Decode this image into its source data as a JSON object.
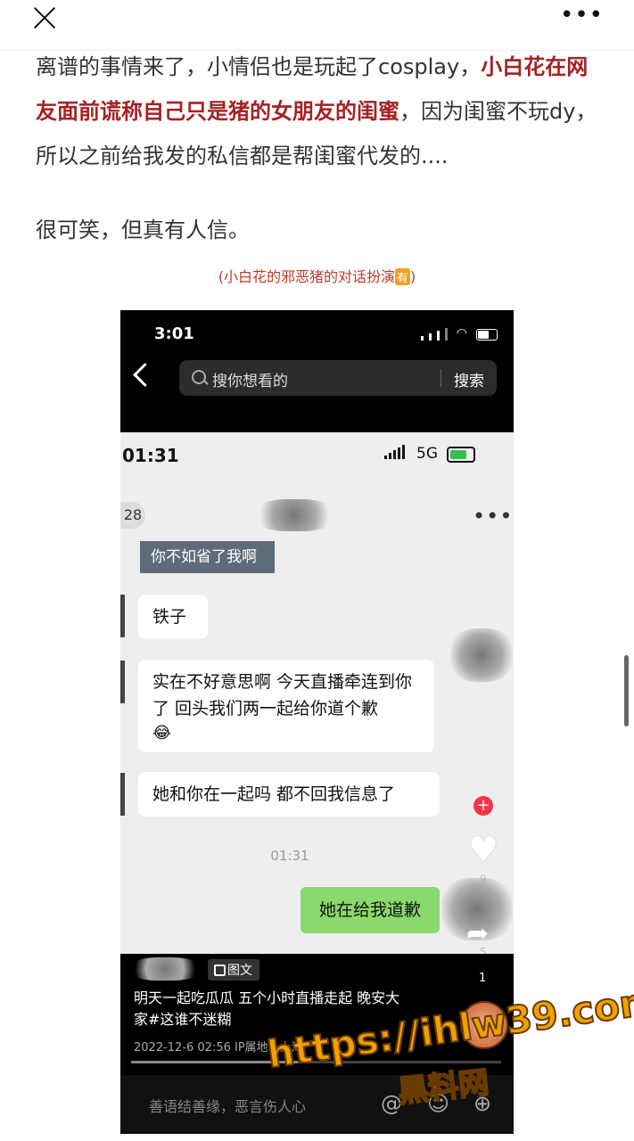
{
  "header": {
    "close": "close",
    "more": "•••"
  },
  "article": {
    "p1_part1": "离谱的事情来了，小情侣也是玩起了cosplay，",
    "p1_highlight": "小白花在网友面前谎称自己只是猪的女朋友的闺蜜",
    "p1_part2": "，因为闺蜜不玩dy，所以之前给我发的私信都是帮闺蜜代发的....",
    "p2": "很可笑，但真有人信。",
    "caption_text": "(小白花的邪恶猪的对话扮演",
    "caption_badge": "有",
    "caption_end": ")"
  },
  "phone": {
    "status_time": "3:01",
    "search_placeholder": "搜你想看的",
    "search_button": "搜索",
    "inner_time": "01:31",
    "network": "5G",
    "pill_number": "28",
    "banner_text": "你不如省了我啊",
    "messages": [
      {
        "text": "铁子"
      },
      {
        "text": "实在不好意思啊 今天直播牵连到你了 回头我们两一起给你道个歉"
      },
      {
        "text": "她和你在一起吗 都不回我信息了"
      }
    ],
    "emoji": "😂",
    "message_time": "01:31",
    "sent_message": "她在给我道歉",
    "like_count": "9",
    "comment_count": "5",
    "share_count": "1",
    "tag": "图文",
    "description": "明天一起吃瓜瓜 五个小时直播走起 晚安大家#这谁不迷糊",
    "meta": "2022-12-6 02:56  IP属地：上海",
    "comment_placeholder": "善语结善缘，恶言伤人心"
  },
  "watermark": {
    "url": "https://ihlw39.com",
    "site": "黑料网"
  }
}
